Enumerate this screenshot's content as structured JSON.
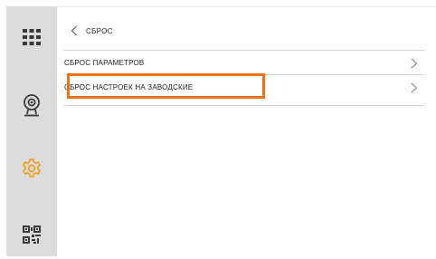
{
  "sidebar": {
    "items": [
      {
        "icon": "grid-icon",
        "active": false
      },
      {
        "icon": "webcam-icon",
        "active": false
      },
      {
        "icon": "gear-icon",
        "active": true
      },
      {
        "icon": "qr-code-icon",
        "active": false
      }
    ],
    "active_color": "#f0a01e",
    "icon_color": "#3a3a3a"
  },
  "header": {
    "back_icon": "chevron-left-icon",
    "title": "СБРОС"
  },
  "menu": {
    "items": [
      {
        "label": "СБРОС ПАРАМЕТРОВ",
        "icon": "chevron-right-icon"
      },
      {
        "label": "СБРОС НАСТРОЕК НА ЗАВОДСКИЕ",
        "icon": "chevron-right-icon",
        "highlighted": true
      }
    ]
  },
  "highlight_color": "#e8731e"
}
